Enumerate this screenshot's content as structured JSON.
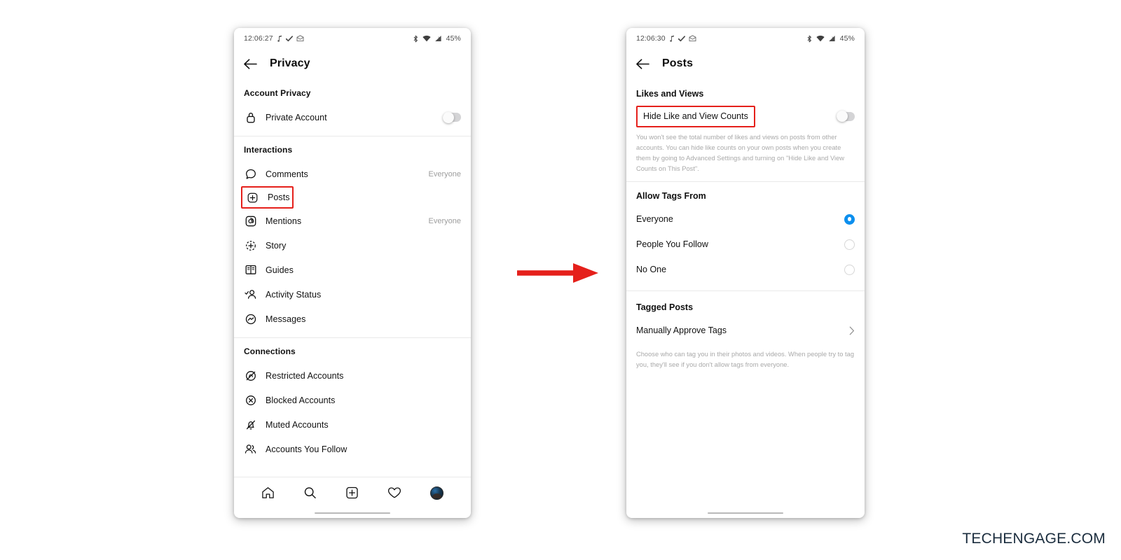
{
  "watermark": "TECHENGAGE.COM",
  "arrow": {
    "name": "flow-arrow",
    "color": "#e5201b"
  },
  "highlight_color": "#e5201b",
  "accent_color": "#0c8fee",
  "left_phone": {
    "statusbar": {
      "time": "12:06:27",
      "battery": "45%",
      "left_icons": [
        "music-note-icon",
        "check-icon",
        "mail-icon"
      ],
      "right_icons": [
        "bluetooth-icon",
        "wifi-icon",
        "signal-icon"
      ]
    },
    "navbar": {
      "back": "back-arrow-icon",
      "title": "Privacy"
    },
    "sections": [
      {
        "heading": "Account Privacy",
        "rows": [
          {
            "icon": "lock-icon",
            "label": "Private Account",
            "control": "toggle",
            "toggle_on": false
          }
        ]
      },
      {
        "heading": "Interactions",
        "rows": [
          {
            "icon": "comment-icon",
            "label": "Comments",
            "value": "Everyone"
          },
          {
            "icon": "plus-square-icon",
            "label": "Posts",
            "value": "",
            "highlighted": true
          },
          {
            "icon": "at-icon",
            "label": "Mentions",
            "value": "Everyone"
          },
          {
            "icon": "story-plus-icon",
            "label": "Story",
            "value": ""
          },
          {
            "icon": "guides-icon",
            "label": "Guides",
            "value": ""
          },
          {
            "icon": "activity-status-icon",
            "label": "Activity Status",
            "value": ""
          },
          {
            "icon": "messenger-icon",
            "label": "Messages",
            "value": ""
          }
        ]
      },
      {
        "heading": "Connections",
        "rows": [
          {
            "icon": "restricted-icon",
            "label": "Restricted Accounts",
            "value": ""
          },
          {
            "icon": "blocked-icon",
            "label": "Blocked Accounts",
            "value": ""
          },
          {
            "icon": "muted-bell-icon",
            "label": "Muted Accounts",
            "value": ""
          },
          {
            "icon": "people-icon",
            "label": "Accounts You Follow",
            "value": ""
          }
        ]
      }
    ],
    "tabbar": [
      "home-icon",
      "search-icon",
      "create-plus-icon",
      "heart-icon",
      "profile-avatar"
    ]
  },
  "right_phone": {
    "statusbar": {
      "time": "12:06:30",
      "battery": "45%",
      "left_icons": [
        "music-note-icon",
        "check-icon",
        "mail-icon"
      ],
      "right_icons": [
        "bluetooth-icon",
        "wifi-icon",
        "signal-icon"
      ]
    },
    "navbar": {
      "back": "back-arrow-icon",
      "title": "Posts"
    },
    "likes_section": {
      "heading": "Likes and Views",
      "row_label": "Hide Like and View Counts",
      "row_highlighted": true,
      "toggle_on": false,
      "help": "You won't see the total number of likes and views on posts from other accounts. You can hide like counts on your own posts when you create them by going to Advanced Settings and turning on \"Hide Like and View Counts on This Post\"."
    },
    "tags_section": {
      "heading": "Allow Tags From",
      "options": [
        {
          "label": "Everyone",
          "selected": true
        },
        {
          "label": "People You Follow",
          "selected": false
        },
        {
          "label": "No One",
          "selected": false
        }
      ]
    },
    "tagged_section": {
      "heading": "Tagged Posts",
      "row_label": "Manually Approve Tags",
      "chevron": "chevron-right-icon",
      "help": "Choose who can tag you in their photos and videos. When people try to tag you, they'll see if you don't allow tags from everyone."
    }
  }
}
